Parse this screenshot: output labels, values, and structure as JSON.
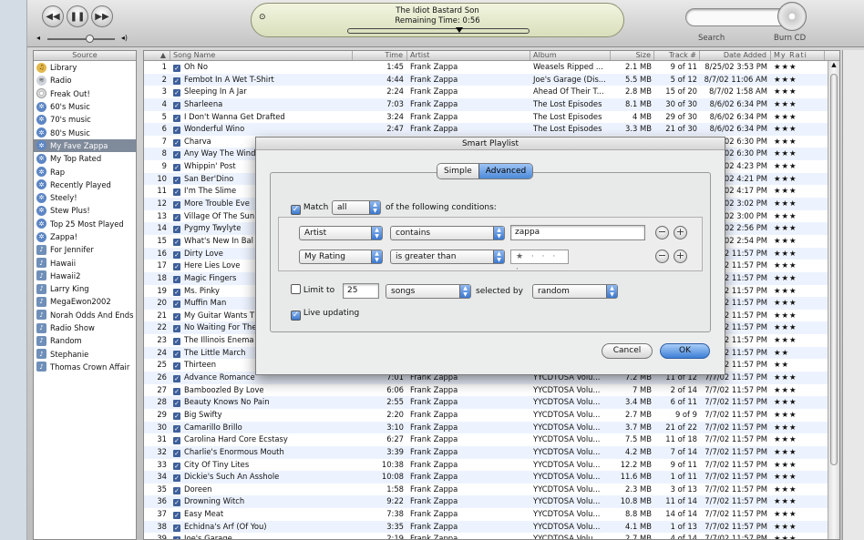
{
  "player": {
    "song_title": "The Idiot Bastard Son",
    "remaining": "Remaining Time: 0:56",
    "search_label": "Search",
    "burn_label": "Burn CD"
  },
  "source": {
    "header": "Source",
    "items": [
      {
        "label": "Library",
        "icon": "library-icon"
      },
      {
        "label": "Radio",
        "icon": "radio-icon"
      },
      {
        "label": "Freak Out!",
        "icon": "cd-icon"
      },
      {
        "label": "60's Music",
        "icon": "smart-playlist-icon"
      },
      {
        "label": "70's music",
        "icon": "smart-playlist-icon"
      },
      {
        "label": "80's Music",
        "icon": "smart-playlist-icon"
      },
      {
        "label": "My Fave Zappa",
        "icon": "smart-playlist-icon",
        "selected": true
      },
      {
        "label": "My Top Rated",
        "icon": "smart-playlist-icon"
      },
      {
        "label": "Rap",
        "icon": "smart-playlist-icon"
      },
      {
        "label": "Recently Played",
        "icon": "smart-playlist-icon"
      },
      {
        "label": "Steely!",
        "icon": "smart-playlist-icon"
      },
      {
        "label": "Stew Plus!",
        "icon": "smart-playlist-icon"
      },
      {
        "label": "Top 25 Most Played",
        "icon": "smart-playlist-icon"
      },
      {
        "label": "Zappa!",
        "icon": "smart-playlist-icon"
      },
      {
        "label": "For Jennifer",
        "icon": "playlist-icon"
      },
      {
        "label": "Hawaii",
        "icon": "playlist-icon"
      },
      {
        "label": "Hawaii2",
        "icon": "playlist-icon"
      },
      {
        "label": "Larry King",
        "icon": "playlist-icon"
      },
      {
        "label": "MegaEwon2002",
        "icon": "playlist-icon"
      },
      {
        "label": "Norah Odds And Ends",
        "icon": "playlist-icon"
      },
      {
        "label": "Radio Show",
        "icon": "playlist-icon"
      },
      {
        "label": "Random",
        "icon": "playlist-icon"
      },
      {
        "label": "Stephanie",
        "icon": "playlist-icon"
      },
      {
        "label": "Thomas Crown Affair",
        "icon": "playlist-icon"
      }
    ]
  },
  "table": {
    "headers": [
      "▲",
      "Song Name",
      "Time",
      "Artist",
      "Album",
      "Size",
      "Track #",
      "Date Added",
      "My Rati"
    ],
    "rows": [
      [
        "1",
        "Oh No",
        "1:45",
        "Frank Zappa",
        "Weasels Ripped ...",
        "2.1 MB",
        "9 of 11",
        "8/25/02 3:53 PM",
        "★★★"
      ],
      [
        "2",
        "Fembot In A Wet T-Shirt",
        "4:44",
        "Frank Zappa",
        "Joe's Garage (Dis...",
        "5.5 MB",
        "5 of 12",
        "8/7/02 11:06 AM",
        "★★★"
      ],
      [
        "3",
        "Sleeping In A Jar",
        "2:24",
        "Frank Zappa",
        "Ahead Of Their T...",
        "2.8 MB",
        "15 of 20",
        "8/7/02 1:58 AM",
        "★★★"
      ],
      [
        "4",
        "Sharleena",
        "7:03",
        "Frank Zappa",
        "The Lost Episodes",
        "8.1 MB",
        "30 of 30",
        "8/6/02 6:34 PM",
        "★★★"
      ],
      [
        "5",
        "I Don't Wanna Get Drafted",
        "3:24",
        "Frank Zappa",
        "The Lost Episodes",
        "4 MB",
        "29 of 30",
        "8/6/02 6:34 PM",
        "★★★"
      ],
      [
        "6",
        "Wonderful Wino",
        "2:47",
        "Frank Zappa",
        "The Lost Episodes",
        "3.3 MB",
        "21 of 30",
        "8/6/02 6:34 PM",
        "★★★"
      ],
      [
        "7",
        "Charva",
        "",
        "",
        "",
        "",
        "",
        "8/6/02 6:30 PM",
        "★★★"
      ],
      [
        "8",
        "Any Way The Wind",
        "",
        "",
        "",
        "",
        "",
        "8/6/02 6:30 PM",
        "★★★"
      ],
      [
        "9",
        "Whippin' Post",
        "",
        "",
        "",
        "",
        "",
        "8/1/02 4:23 PM",
        "★★★"
      ],
      [
        "10",
        "San Ber'Dino",
        "",
        "",
        "",
        "",
        "",
        "8/1/02 4:21 PM",
        "★★★"
      ],
      [
        "11",
        "I'm The Slime",
        "",
        "",
        "",
        "",
        "",
        "8/1/02 4:17 PM",
        "★★★"
      ],
      [
        "12",
        "More Trouble Eve",
        "",
        "",
        "",
        "",
        "",
        "8/1/02 3:02 PM",
        "★★★"
      ],
      [
        "13",
        "Village Of The Sun",
        "",
        "",
        "",
        "",
        "",
        "8/1/02 3:00 PM",
        "★★★"
      ],
      [
        "14",
        "Pygmy Twylyte",
        "",
        "",
        "",
        "",
        "",
        "8/1/02 2:56 PM",
        "★★★"
      ],
      [
        "15",
        "What's New In Bal",
        "",
        "",
        "",
        "",
        "",
        "8/1/02 2:54 PM",
        "★★★"
      ],
      [
        "16",
        "Dirty Love",
        "",
        "",
        "",
        "",
        "",
        "7/7/02 11:57 PM",
        "★★★"
      ],
      [
        "17",
        "Here Lies Love",
        "",
        "",
        "",
        "",
        "",
        "7/7/02 11:57 PM",
        "★★★"
      ],
      [
        "18",
        "Magic Fingers",
        "",
        "",
        "",
        "",
        "",
        "7/7/02 11:57 PM",
        "★★★"
      ],
      [
        "19",
        "Ms. Pinky",
        "",
        "",
        "",
        "",
        "",
        "7/7/02 11:57 PM",
        "★★★"
      ],
      [
        "20",
        "Muffin Man",
        "",
        "",
        "",
        "",
        "",
        "7/7/02 11:57 PM",
        "★★★"
      ],
      [
        "21",
        "My Guitar Wants T",
        "",
        "",
        "",
        "",
        "",
        "7/7/02 11:57 PM",
        "★★★"
      ],
      [
        "22",
        "No Waiting For The",
        "",
        "",
        "",
        "",
        "",
        "7/7/02 11:57 PM",
        "★★★"
      ],
      [
        "23",
        "The Illinois Enema",
        "",
        "",
        "",
        "",
        "",
        "7/7/02 11:57 PM",
        "★★★"
      ],
      [
        "24",
        "The Little March",
        "",
        "",
        "",
        "",
        "",
        "7/7/02 11:57 PM",
        "★★"
      ],
      [
        "25",
        "Thirteen",
        "",
        "",
        "",
        "",
        "",
        "7/7/02 11:57 PM",
        "★★"
      ],
      [
        "26",
        "Advance Romance",
        "7:01",
        "Frank Zappa",
        "YYCDTOSA Volu...",
        "7.2 MB",
        "11 of 12",
        "7/7/02 11:57 PM",
        "★★★"
      ],
      [
        "27",
        "Bamboozled By Love",
        "6:06",
        "Frank Zappa",
        "YYCDTOSA Volu...",
        "7 MB",
        "2 of 14",
        "7/7/02 11:57 PM",
        "★★★"
      ],
      [
        "28",
        "Beauty Knows No Pain",
        "2:55",
        "Frank Zappa",
        "YYCDTOSA Volu...",
        "3.4 MB",
        "6 of 11",
        "7/7/02 11:57 PM",
        "★★★"
      ],
      [
        "29",
        "Big Swifty",
        "2:20",
        "Frank Zappa",
        "YYCDTOSA Volu...",
        "2.7 MB",
        "9 of 9",
        "7/7/02 11:57 PM",
        "★★★"
      ],
      [
        "30",
        "Camarillo Brillo",
        "3:10",
        "Frank Zappa",
        "YYCDTOSA Volu...",
        "3.7 MB",
        "21 of 22",
        "7/7/02 11:57 PM",
        "★★★"
      ],
      [
        "31",
        "Carolina Hard Core Ecstasy",
        "6:27",
        "Frank Zappa",
        "YYCDTOSA Volu...",
        "7.5 MB",
        "11 of 18",
        "7/7/02 11:57 PM",
        "★★★"
      ],
      [
        "32",
        "Charlie's Enormous Mouth",
        "3:39",
        "Frank Zappa",
        "YYCDTOSA Volu...",
        "4.2 MB",
        "7 of 14",
        "7/7/02 11:57 PM",
        "★★★"
      ],
      [
        "33",
        "City Of Tiny Lites",
        "10:38",
        "Frank Zappa",
        "YYCDTOSA Volu...",
        "12.2 MB",
        "9 of 11",
        "7/7/02 11:57 PM",
        "★★★"
      ],
      [
        "34",
        "Dickie's Such An Asshole",
        "10:08",
        "Frank Zappa",
        "YYCDTOSA Volu...",
        "11.6 MB",
        "1 of 11",
        "7/7/02 11:57 PM",
        "★★★"
      ],
      [
        "35",
        "Doreen",
        "1:58",
        "Frank Zappa",
        "YYCDTOSA Volu...",
        "2.3 MB",
        "3 of 13",
        "7/7/02 11:57 PM",
        "★★★"
      ],
      [
        "36",
        "Drowning Witch",
        "9:22",
        "Frank Zappa",
        "YYCDTOSA Volu...",
        "10.8 MB",
        "11 of 14",
        "7/7/02 11:57 PM",
        "★★★"
      ],
      [
        "37",
        "Easy Meat",
        "7:38",
        "Frank Zappa",
        "YYCDTOSA Volu...",
        "8.8 MB",
        "14 of 14",
        "7/7/02 11:57 PM",
        "★★★"
      ],
      [
        "38",
        "Echidna's Arf (Of You)",
        "3:35",
        "Frank Zappa",
        "YYCDTOSA Volu...",
        "4.1 MB",
        "1 of 13",
        "7/7/02 11:57 PM",
        "★★★"
      ],
      [
        "39",
        "Joe's Garage",
        "2:19",
        "Frank Zappa",
        "YYCDTOSA Volu...",
        "2.7 MB",
        "4 of 14",
        "7/7/02 11:57 PM",
        "★★★"
      ]
    ]
  },
  "dialog": {
    "title": "Smart Playlist",
    "tab_simple": "Simple",
    "tab_advanced": "Advanced",
    "match_label": "Match",
    "match_value": "all",
    "match_suffix": "of the following conditions:",
    "cond1_field": "Artist",
    "cond1_op": "contains",
    "cond1_value": "zappa",
    "cond2_field": "My Rating",
    "cond2_op": "is greater than",
    "cond2_value": "★ · · · ·",
    "limit_label": "Limit to",
    "limit_value": "25",
    "limit_unit": "songs",
    "selected_by_label": "selected by",
    "selected_by_value": "random",
    "live_label": "Live updating",
    "cancel": "Cancel",
    "ok": "OK"
  }
}
